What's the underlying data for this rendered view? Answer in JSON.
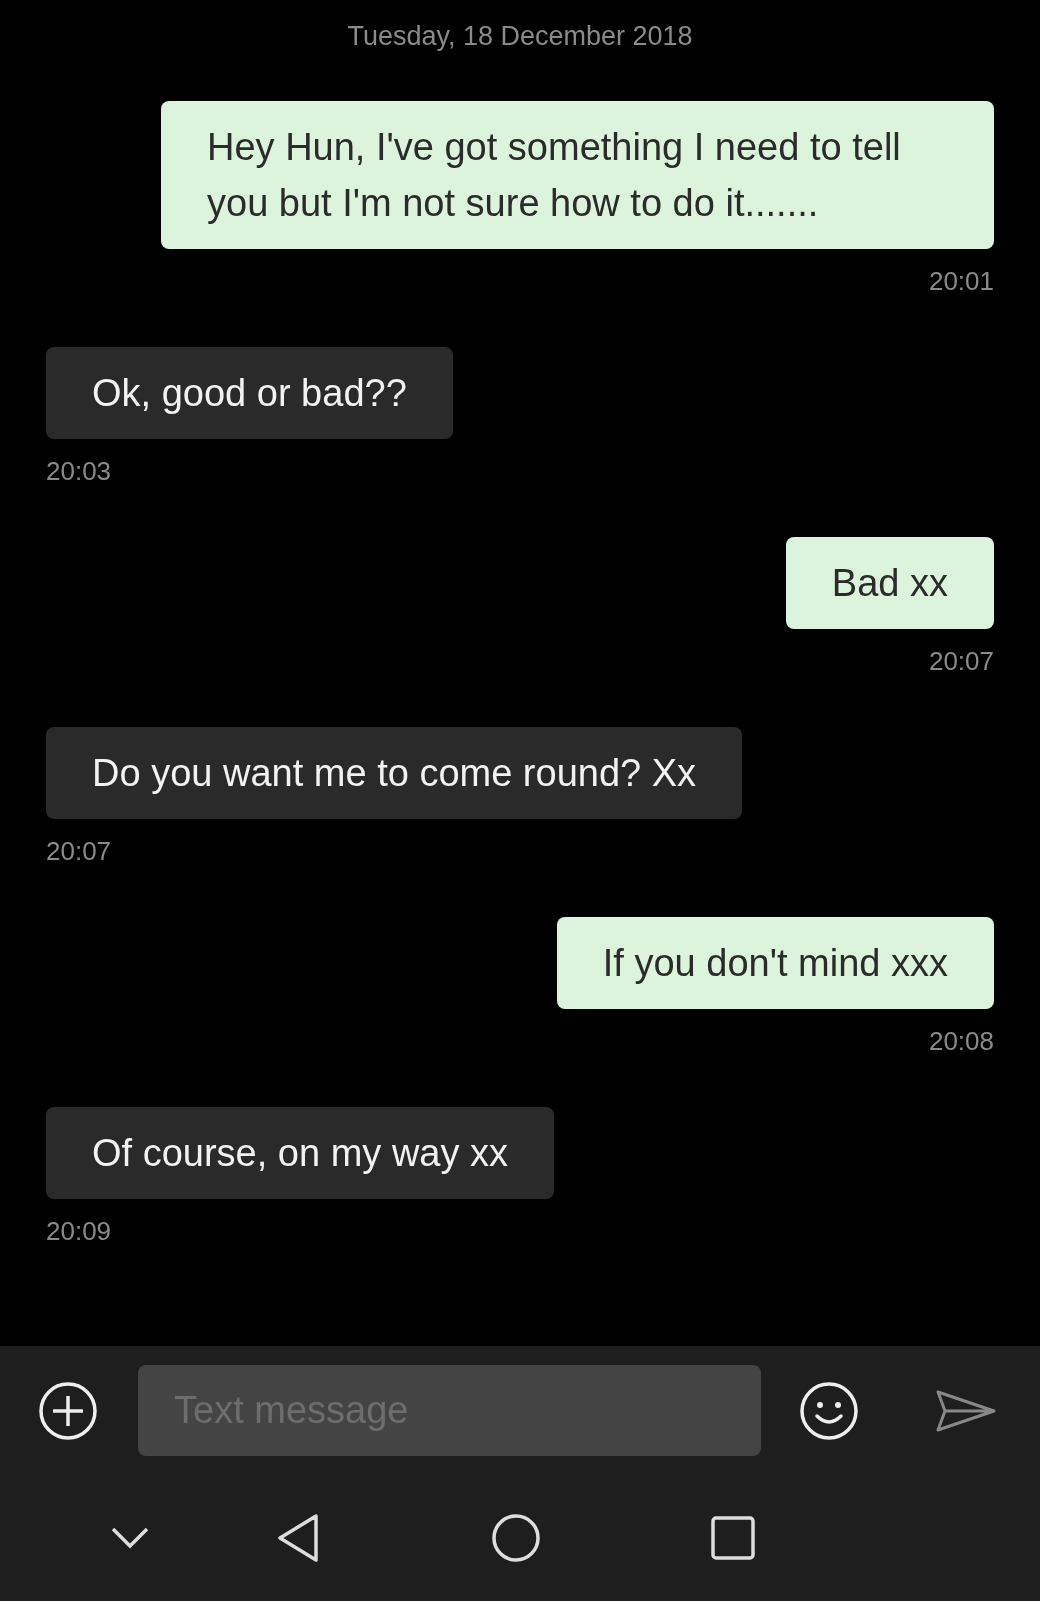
{
  "date": "Tuesday, 18 December 2018",
  "messages": [
    {
      "kind": "sent",
      "text": "Hey Hun, I've got something I need to tell you but I'm not sure how to do it.......",
      "time": "20:01"
    },
    {
      "kind": "received",
      "text": "Ok, good or bad??",
      "time": "20:03"
    },
    {
      "kind": "sent",
      "text": "Bad xx",
      "time": "20:07"
    },
    {
      "kind": "received",
      "text": "Do you want me to come round? Xx",
      "time": "20:07"
    },
    {
      "kind": "sent",
      "text": "If you don't mind xxx",
      "time": "20:08"
    },
    {
      "kind": "received",
      "text": "Of course, on my way xx",
      "time": "20:09"
    }
  ],
  "composer": {
    "placeholder": "Text message"
  }
}
